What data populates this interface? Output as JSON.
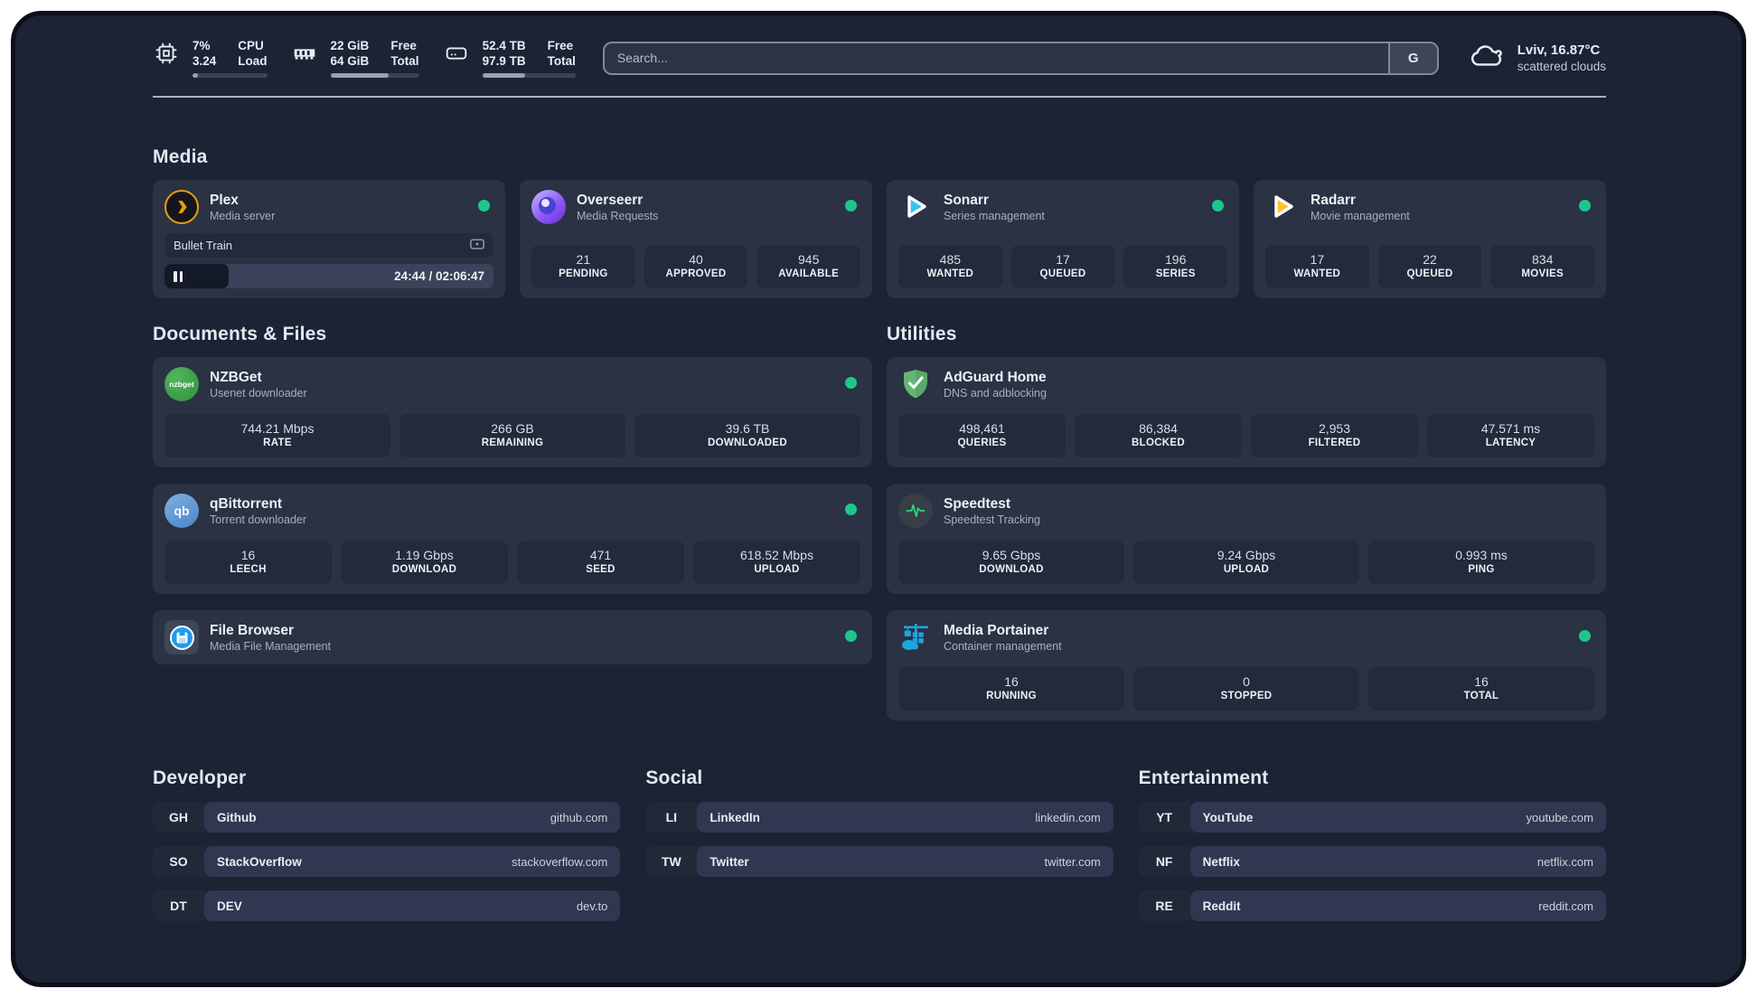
{
  "header": {
    "metrics": [
      {
        "icon": "cpu-icon",
        "value_top": "7%",
        "value_bottom": "3.24",
        "label_top": "CPU",
        "label_bottom": "Load",
        "progress_pct": 7
      },
      {
        "icon": "ram-icon",
        "value_top": "22 GiB",
        "value_bottom": "64 GiB",
        "label_top": "Free",
        "label_bottom": "Total",
        "progress_pct": 66
      },
      {
        "icon": "disk-icon",
        "value_top": "52.4 TB",
        "value_bottom": "97.9 TB",
        "label_top": "Free",
        "label_bottom": "Total",
        "progress_pct": 46
      }
    ],
    "search": {
      "placeholder": "Search...",
      "engine_button": "G"
    },
    "weather": {
      "icon": "cloud-icon",
      "location_temperature": "Lviv, 16.87°C",
      "condition": "scattered clouds"
    }
  },
  "media": {
    "section_title": "Media",
    "plex": {
      "icon": "plex-icon",
      "title": "Plex",
      "subtitle": "Media server",
      "online": true,
      "now_playing": {
        "title": "Bullet Train",
        "state": "paused",
        "time_display": "24:44 / 02:06:47",
        "progress_pct": 19.5
      }
    },
    "overseerr": {
      "icon": "overseerr-icon",
      "title": "Overseerr",
      "subtitle": "Media Requests",
      "online": true,
      "stats": [
        {
          "value": "21",
          "label": "PENDING"
        },
        {
          "value": "40",
          "label": "APPROVED"
        },
        {
          "value": "945",
          "label": "AVAILABLE"
        }
      ]
    },
    "sonarr": {
      "icon": "sonarr-icon",
      "title": "Sonarr",
      "subtitle": "Series management",
      "online": true,
      "stats": [
        {
          "value": "485",
          "label": "WANTED"
        },
        {
          "value": "17",
          "label": "QUEUED"
        },
        {
          "value": "196",
          "label": "SERIES"
        }
      ]
    },
    "radarr": {
      "icon": "radarr-icon",
      "title": "Radarr",
      "subtitle": "Movie management",
      "online": true,
      "stats": [
        {
          "value": "17",
          "label": "WANTED"
        },
        {
          "value": "22",
          "label": "QUEUED"
        },
        {
          "value": "834",
          "label": "MOVIES"
        }
      ]
    }
  },
  "documents": {
    "section_title": "Documents & Files",
    "nzbget": {
      "icon": "nzbget-icon",
      "icon_text": "nzbget",
      "title": "NZBGet",
      "subtitle": "Usenet downloader",
      "online": true,
      "stats": [
        {
          "value": "744.21 Mbps",
          "label": "RATE"
        },
        {
          "value": "266 GB",
          "label": "REMAINING"
        },
        {
          "value": "39.6 TB",
          "label": "DOWNLOADED"
        }
      ]
    },
    "qbittorrent": {
      "icon": "qbittorrent-icon",
      "icon_text": "qb",
      "title": "qBittorrent",
      "subtitle": "Torrent downloader",
      "online": true,
      "stats": [
        {
          "value": "16",
          "label": "LEECH"
        },
        {
          "value": "1.19 Gbps",
          "label": "DOWNLOAD"
        },
        {
          "value": "471",
          "label": "SEED"
        },
        {
          "value": "618.52 Mbps",
          "label": "UPLOAD"
        }
      ]
    },
    "filebrowser": {
      "icon": "filebrowser-icon",
      "title": "File Browser",
      "subtitle": "Media File Management",
      "online": true
    }
  },
  "utilities": {
    "section_title": "Utilities",
    "adguard": {
      "icon": "adguard-icon",
      "title": "AdGuard Home",
      "subtitle": "DNS and adblocking",
      "stats": [
        {
          "value": "498,461",
          "label": "QUERIES"
        },
        {
          "value": "86,384",
          "label": "BLOCKED"
        },
        {
          "value": "2,953",
          "label": "FILTERED"
        },
        {
          "value": "47.571 ms",
          "label": "LATENCY"
        }
      ]
    },
    "speedtest": {
      "icon": "speedtest-icon",
      "title": "Speedtest",
      "subtitle": "Speedtest Tracking",
      "stats": [
        {
          "value": "9.65 Gbps",
          "label": "DOWNLOAD"
        },
        {
          "value": "9.24 Gbps",
          "label": "UPLOAD"
        },
        {
          "value": "0.993 ms",
          "label": "PING"
        }
      ]
    },
    "portainer": {
      "icon": "portainer-icon",
      "title": "Media Portainer",
      "subtitle": "Container management",
      "online": true,
      "stats": [
        {
          "value": "16",
          "label": "RUNNING"
        },
        {
          "value": "0",
          "label": "STOPPED"
        },
        {
          "value": "16",
          "label": "TOTAL"
        }
      ]
    }
  },
  "links": {
    "developer": {
      "section_title": "Developer",
      "items": [
        {
          "abbr": "GH",
          "name": "Github",
          "url": "github.com"
        },
        {
          "abbr": "SO",
          "name": "StackOverflow",
          "url": "stackoverflow.com"
        },
        {
          "abbr": "DT",
          "name": "DEV",
          "url": "dev.to"
        }
      ]
    },
    "social": {
      "section_title": "Social",
      "items": [
        {
          "abbr": "LI",
          "name": "LinkedIn",
          "url": "linkedin.com"
        },
        {
          "abbr": "TW",
          "name": "Twitter",
          "url": "twitter.com"
        }
      ]
    },
    "entertainment": {
      "section_title": "Entertainment",
      "items": [
        {
          "abbr": "YT",
          "name": "YouTube",
          "url": "youtube.com"
        },
        {
          "abbr": "NF",
          "name": "Netflix",
          "url": "netflix.com"
        },
        {
          "abbr": "RE",
          "name": "Reddit",
          "url": "reddit.com"
        }
      ]
    }
  },
  "colors": {
    "status_online": "#1fc68c",
    "page_bg": "#1c2334",
    "card_bg": "#2a3244",
    "brand_blue": "#1ba6df"
  }
}
